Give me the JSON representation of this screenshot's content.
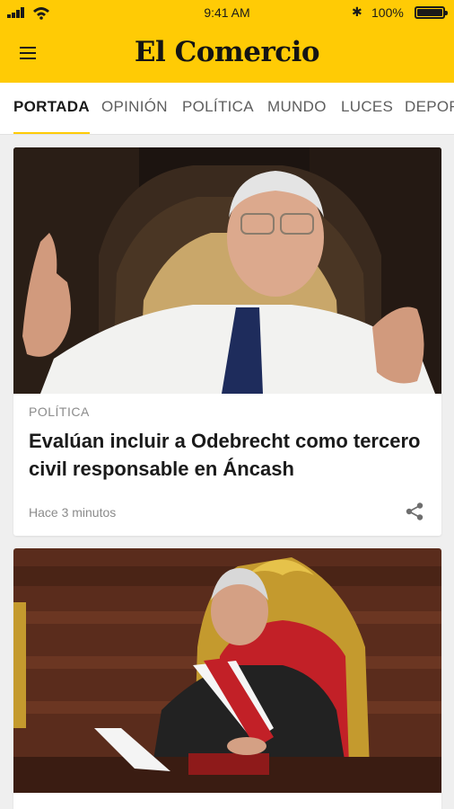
{
  "status_bar": {
    "time": "9:41 AM",
    "battery_pct": "100%",
    "battery_level": 1.0,
    "icons": [
      "signal-icon",
      "wifi-icon",
      "bluetooth-icon",
      "battery-icon"
    ]
  },
  "header": {
    "logo": "El Comercio",
    "menu_icon": "hamburger-menu-icon",
    "background_color": "#ffcb05"
  },
  "tabs": [
    {
      "label": "PORTADA",
      "active": true
    },
    {
      "label": "OPINIÓN",
      "active": false
    },
    {
      "label": "POLÍTICA",
      "active": false
    },
    {
      "label": "MUNDO",
      "active": false
    },
    {
      "label": "LUCES",
      "active": false
    },
    {
      "label": "DEPORTES",
      "active": false
    }
  ],
  "articles": [
    {
      "section": "POLÍTICA",
      "headline": "Evalúan incluir a Odebrecht como tercero civil responsable en Áncash",
      "time": "Hace 3 minutos",
      "share_icon": "share-icon"
    }
  ]
}
